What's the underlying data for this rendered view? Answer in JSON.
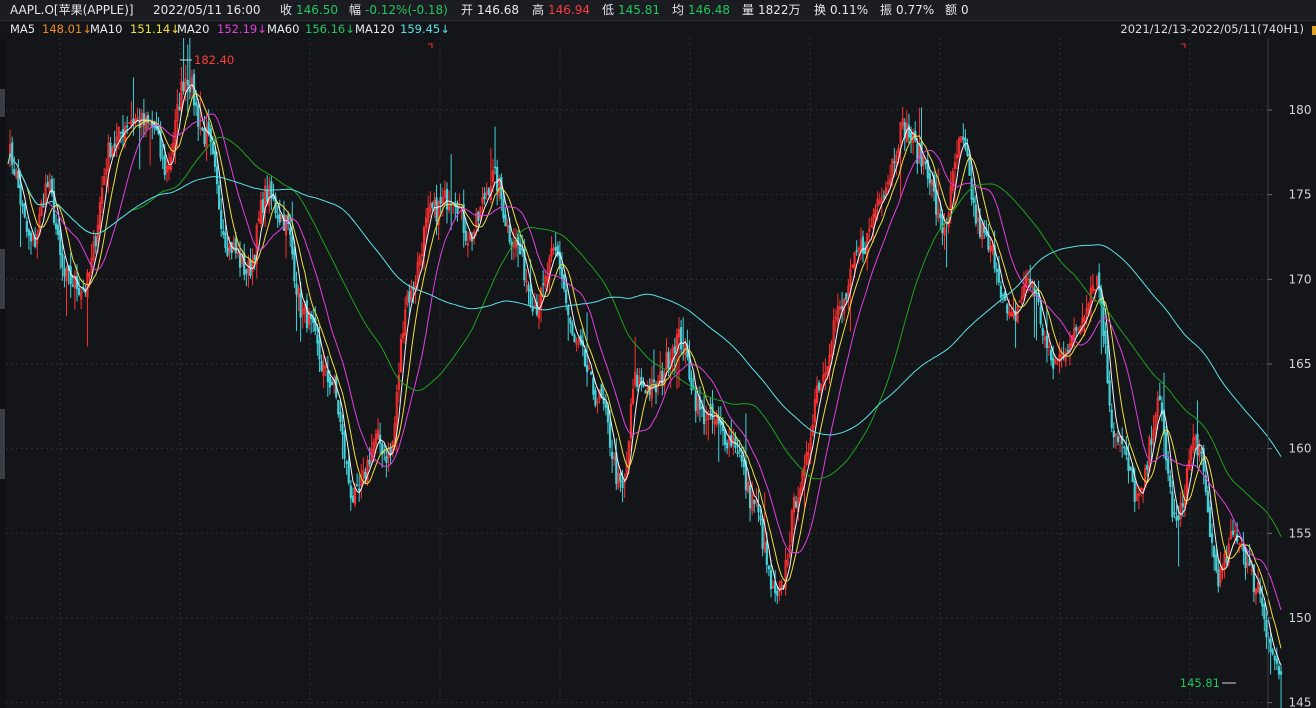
{
  "header": {
    "symbol": "AAPL.O[苹果(APPLE)]",
    "datetime": "2022/05/11 16:00",
    "close_label": "收",
    "close_value": "146.50",
    "change_label": "幅",
    "change_value": "-0.12%(-0.18)",
    "open_label": "开",
    "open_value": "146.68",
    "high_label": "高",
    "high_value": "146.94",
    "low_label": "低",
    "low_value": "145.81",
    "avg_label": "均",
    "avg_value": "146.48",
    "vol_label": "量",
    "vol_value": "1822万",
    "turnover_label": "换",
    "turnover_value": "0.11%",
    "amplitude_label": "振",
    "amplitude_value": "0.77%",
    "amount_label": "额",
    "amount_value": "0"
  },
  "ma_bar": {
    "items": [
      {
        "label": "MA5",
        "value": "148.01↓",
        "color": "#f08c1e"
      },
      {
        "label": "MA10",
        "value": "151.14↓",
        "color": "#f0e040"
      },
      {
        "label": "MA20",
        "value": "152.19↓",
        "color": "#e040e0"
      },
      {
        "label": "MA60",
        "value": "156.16↓",
        "color": "#22c55e"
      },
      {
        "label": "MA120",
        "value": "159.45↓",
        "color": "#5ce0e8"
      }
    ],
    "range": "2021/12/13-2022/05/11(740H1)"
  },
  "colors": {
    "up": "#ff3030",
    "down": "#44d0d8",
    "ma5": "#f5f5f5",
    "ma10": "#f0e040",
    "ma20": "#e040e0",
    "ma60": "#1ea21e",
    "ma120": "#5ce0e8",
    "grid": "#2b2e35",
    "axis_text": "#d0d3d8"
  },
  "chart_data": {
    "type": "candlestick",
    "timeframe": "H1",
    "period": "2021/12/13-2022/05/11",
    "bars": 740,
    "y_ticks": [
      145,
      150,
      155,
      160,
      165,
      170,
      175,
      180
    ],
    "ylim": [
      144.8,
      183.9
    ],
    "max_label": "182.40",
    "min_label": "145.81",
    "grid": true,
    "close_path": [
      {
        "x": 0.0,
        "y": 177.5
      },
      {
        "x": 0.02,
        "y": 172.0
      },
      {
        "x": 0.032,
        "y": 175.5
      },
      {
        "x": 0.047,
        "y": 170.0
      },
      {
        "x": 0.062,
        "y": 169.5
      },
      {
        "x": 0.085,
        "y": 178.0
      },
      {
        "x": 0.1,
        "y": 179.5
      },
      {
        "x": 0.118,
        "y": 179.0
      },
      {
        "x": 0.128,
        "y": 176.5
      },
      {
        "x": 0.145,
        "y": 182.0
      },
      {
        "x": 0.16,
        "y": 178.5
      },
      {
        "x": 0.18,
        "y": 172.0
      },
      {
        "x": 0.195,
        "y": 170.5
      },
      {
        "x": 0.21,
        "y": 175.0
      },
      {
        "x": 0.225,
        "y": 173.5
      },
      {
        "x": 0.24,
        "y": 168.0
      },
      {
        "x": 0.262,
        "y": 164.0
      },
      {
        "x": 0.282,
        "y": 157.0
      },
      {
        "x": 0.3,
        "y": 160.5
      },
      {
        "x": 0.31,
        "y": 159.5
      },
      {
        "x": 0.325,
        "y": 169.0
      },
      {
        "x": 0.345,
        "y": 174.0
      },
      {
        "x": 0.362,
        "y": 175.0
      },
      {
        "x": 0.375,
        "y": 172.5
      },
      {
        "x": 0.395,
        "y": 176.0
      },
      {
        "x": 0.41,
        "y": 172.5
      },
      {
        "x": 0.43,
        "y": 168.5
      },
      {
        "x": 0.445,
        "y": 171.5
      },
      {
        "x": 0.462,
        "y": 166.0
      },
      {
        "x": 0.48,
        "y": 163.0
      },
      {
        "x": 0.5,
        "y": 157.5
      },
      {
        "x": 0.51,
        "y": 164.0
      },
      {
        "x": 0.525,
        "y": 163.5
      },
      {
        "x": 0.545,
        "y": 166.5
      },
      {
        "x": 0.565,
        "y": 162.0
      },
      {
        "x": 0.59,
        "y": 160.5
      },
      {
        "x": 0.605,
        "y": 157.0
      },
      {
        "x": 0.625,
        "y": 151.0
      },
      {
        "x": 0.645,
        "y": 158.0
      },
      {
        "x": 0.66,
        "y": 164.0
      },
      {
        "x": 0.675,
        "y": 168.0
      },
      {
        "x": 0.695,
        "y": 172.0
      },
      {
        "x": 0.712,
        "y": 175.5
      },
      {
        "x": 0.728,
        "y": 179.0
      },
      {
        "x": 0.745,
        "y": 177.0
      },
      {
        "x": 0.76,
        "y": 173.0
      },
      {
        "x": 0.775,
        "y": 178.0
      },
      {
        "x": 0.79,
        "y": 173.0
      },
      {
        "x": 0.8,
        "y": 171.5
      },
      {
        "x": 0.815,
        "y": 167.5
      },
      {
        "x": 0.83,
        "y": 170.0
      },
      {
        "x": 0.85,
        "y": 165.0
      },
      {
        "x": 0.865,
        "y": 166.5
      },
      {
        "x": 0.885,
        "y": 170.0
      },
      {
        "x": 0.9,
        "y": 161.0
      },
      {
        "x": 0.92,
        "y": 157.0
      },
      {
        "x": 0.935,
        "y": 162.5
      },
      {
        "x": 0.95,
        "y": 155.5
      },
      {
        "x": 0.965,
        "y": 160.5
      },
      {
        "x": 0.985,
        "y": 152.5
      },
      {
        "x": 0.998,
        "y": 155.0
      },
      {
        "x": 1.015,
        "y": 152.0
      },
      {
        "x": 1.03,
        "y": 147.5
      },
      {
        "x": 1.035,
        "y": 146.5
      }
    ]
  }
}
